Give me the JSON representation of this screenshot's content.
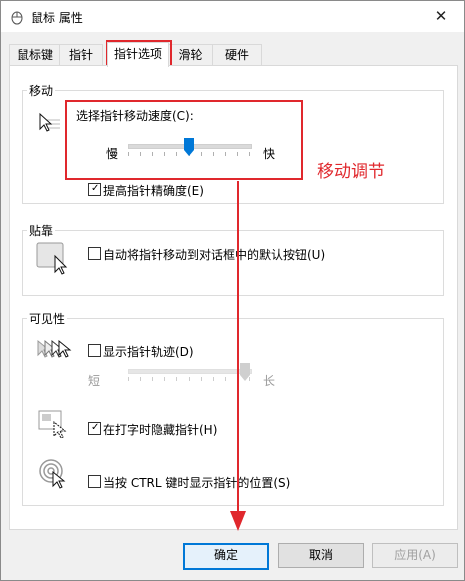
{
  "window": {
    "title": "鼠标 属性",
    "close_glyph": "✕"
  },
  "tabs": [
    {
      "label": "鼠标键"
    },
    {
      "label": "指针"
    },
    {
      "label": "指针选项"
    },
    {
      "label": "滑轮"
    },
    {
      "label": "硬件"
    }
  ],
  "active_tab": "指针选项",
  "motion": {
    "title": "移动",
    "speed_label": "选择指针移动速度(C):",
    "slow_label": "慢",
    "fast_label": "快",
    "speed_value_fraction": 0.5,
    "enhance_precision_label": "提高指针精确度(E)",
    "enhance_precision_checked": true
  },
  "snap": {
    "title": "贴靠",
    "snap_label": "自动将指针移动到对话框中的默认按钮(U)",
    "snap_checked": false
  },
  "visibility": {
    "title": "可见性",
    "trails_label": "显示指针轨迹(D)",
    "trails_checked": false,
    "short_label": "短",
    "long_label": "长",
    "trails_value_fraction": 1.0,
    "hide_typing_label": "在打字时隐藏指针(H)",
    "hide_typing_checked": true,
    "ctrl_label": "当按 CTRL 键时显示指针的位置(S)",
    "ctrl_checked": false
  },
  "buttons": {
    "ok": "确定",
    "cancel": "取消",
    "apply": "应用(A)"
  },
  "annotation": {
    "text": "移动调节",
    "color": "#e0282d"
  },
  "icons": [
    "mouse-icon",
    "pointer-speed-icon",
    "snap-to-icon",
    "pointer-trails-icon",
    "hide-pointer-icon",
    "ctrl-locate-icon"
  ]
}
